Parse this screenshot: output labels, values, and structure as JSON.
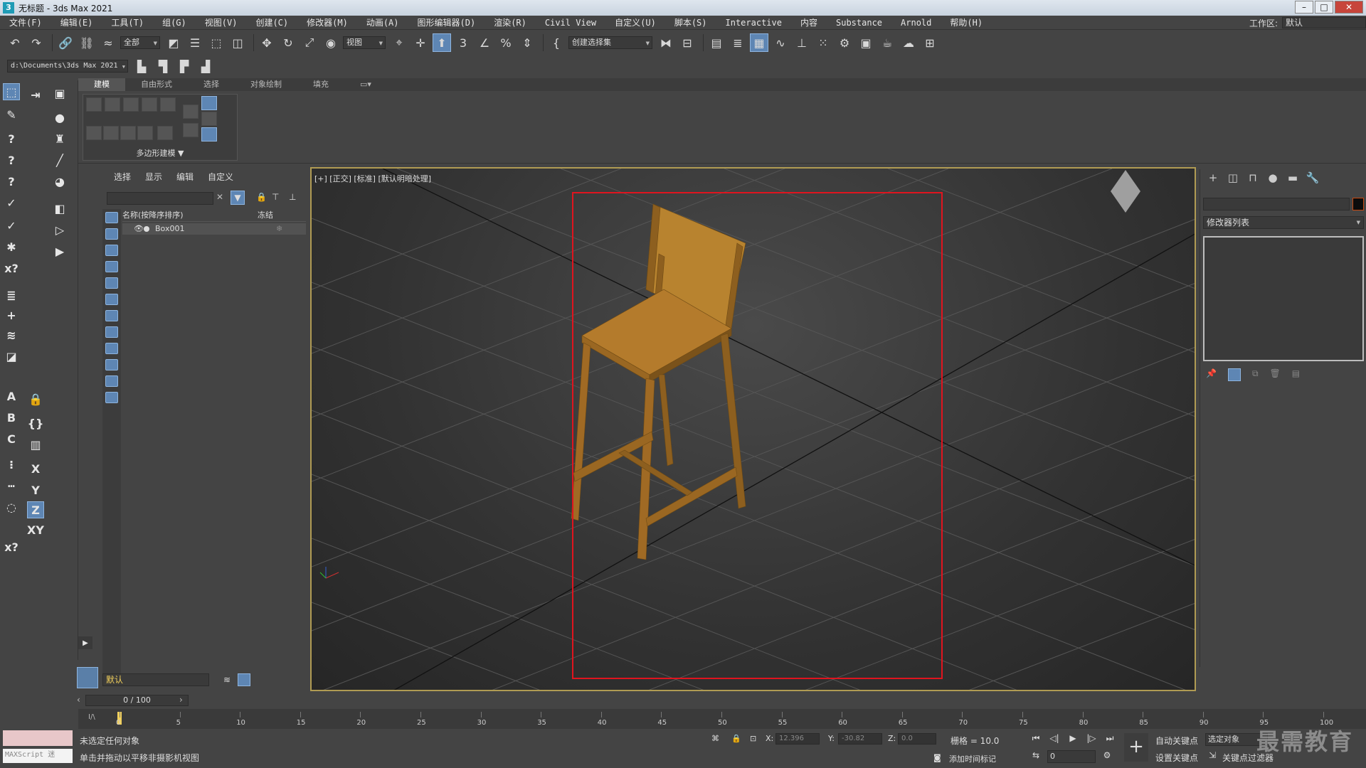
{
  "window": {
    "title": "无标题 - 3ds Max 2021",
    "app_icon": "3"
  },
  "menu": [
    "文件(F)",
    "编辑(E)",
    "工具(T)",
    "组(G)",
    "视图(V)",
    "创建(C)",
    "修改器(M)",
    "动画(A)",
    "图形编辑器(D)",
    "渲染(R)",
    "Civil View",
    "自定义(U)",
    "脚本(S)",
    "Interactive",
    "内容",
    "Substance",
    "Arnold",
    "帮助(H)"
  ],
  "workspace": {
    "label": "工作区:",
    "value": "默认"
  },
  "toolbar": {
    "selection_filter": "全部",
    "ref_coord": "视图",
    "named_selection": "创建选择集"
  },
  "project_path": "d:\\Documents\\3ds Max 2021",
  "ribbon": {
    "tabs": [
      "建模",
      "自由形式",
      "选择",
      "对象绘制",
      "填充"
    ],
    "active_tab": "建模",
    "panel_label": "多边形建模 ▼"
  },
  "scene_explorer": {
    "tabs": [
      "选择",
      "显示",
      "编辑",
      "自定义"
    ],
    "col_name": "名称(按降序排序)",
    "col_frozen": "冻结",
    "objects": [
      "Box001"
    ],
    "layer": "默认"
  },
  "viewport": {
    "label": "[+] [正交] [标准] [默认明暗处理]",
    "object_color": "#b07a2e",
    "frame_color": "#e0141e"
  },
  "command_panel": {
    "modifier_list": "修改器列表"
  },
  "time": {
    "frame": "0 / 100",
    "ticks": [
      0,
      5,
      10,
      15,
      20,
      25,
      30,
      35,
      40,
      45,
      50,
      55,
      60,
      65,
      70,
      75,
      80,
      85,
      90,
      95,
      100
    ]
  },
  "status": {
    "line1": "未选定任何对象",
    "line2": "单击并拖动以平移非摄影机视图",
    "maxscript": "MAXScript 迷",
    "x_label": "X:",
    "x_value": "12.396",
    "y_label": "Y:",
    "y_value": "-30.82",
    "z_label": "Z:",
    "z_value": "0.0",
    "grid": "栅格 = 10.0",
    "add_time_tag": "添加时间标记",
    "auto_key": "自动关键点",
    "set_key": "设置关键点",
    "selected_object": "选定对象",
    "key_filter": "关键点过滤器",
    "frame_spinner": "0"
  },
  "watermark": "最需教育"
}
